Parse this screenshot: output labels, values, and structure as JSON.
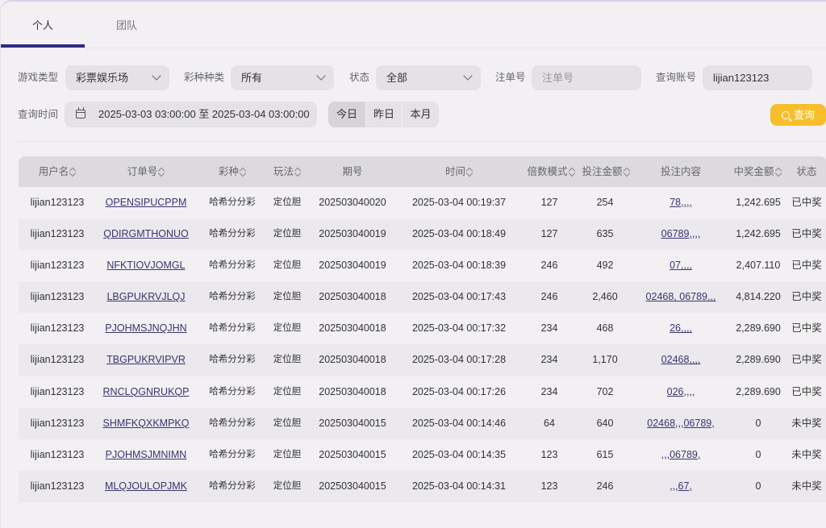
{
  "tabs": [
    {
      "label": "个人"
    },
    {
      "label": "团队"
    }
  ],
  "filters": {
    "game_type_label": "游戏类型",
    "game_type_value": "彩票娱乐场",
    "lottery_label": "彩种种类",
    "lottery_value": "所有",
    "status_label": "状态",
    "status_value": "全部",
    "order_label": "注单号",
    "order_placeholder": "注单号",
    "account_label": "查询账号",
    "account_value": "lijian123123",
    "time_label": "查询时间",
    "time_value": "2025-03-03 03:00:00 至 2025-03-04 03:00:00",
    "quick": [
      "今日",
      "昨日",
      "本月"
    ],
    "query_button": "查询"
  },
  "table": {
    "headers": [
      "用户名",
      "订单号",
      "彩种",
      "玩法",
      "期号",
      "时间",
      "倍数模式",
      "投注金额",
      "投注内容",
      "中奖金额",
      "状态"
    ],
    "rows": [
      [
        "lijian123123",
        "OPENSIPUCPPM",
        "哈希分分彩",
        "定位胆",
        "202503040020",
        "2025-03-04 00:19:37",
        "127",
        "254",
        "78,,,,",
        "1,242.695",
        "已中奖"
      ],
      [
        "lijian123123",
        "QDIRGMTHONUO",
        "哈希分分彩",
        "定位胆",
        "202503040019",
        "2025-03-04 00:18:49",
        "127",
        "635",
        "06789,,,,",
        "1,242.695",
        "已中奖"
      ],
      [
        "lijian123123",
        "NFKTIOVJOMGL",
        "哈希分分彩",
        "定位胆",
        "202503040019",
        "2025-03-04 00:18:39",
        "246",
        "492",
        "07,,,,",
        "2,407.110",
        "已中奖"
      ],
      [
        "lijian123123",
        "LBGPUKRVJLQJ",
        "哈希分分彩",
        "定位胆",
        "202503040018",
        "2025-03-04 00:17:43",
        "246",
        "2,460",
        "02468, 06789,,,",
        "4,814.220",
        "已中奖"
      ],
      [
        "lijian123123",
        "PJOHMSJNQJHN",
        "哈希分分彩",
        "定位胆",
        "202503040018",
        "2025-03-04 00:17:32",
        "234",
        "468",
        "26,,,,",
        "2,289.690",
        "已中奖"
      ],
      [
        "lijian123123",
        "TBGPUKRVIPVR",
        "哈希分分彩",
        "定位胆",
        "202503040018",
        "2025-03-04 00:17:28",
        "234",
        "1,170",
        "02468,,,,",
        "2,289.690",
        "已中奖"
      ],
      [
        "lijian123123",
        "RNCLQGNRUKQP",
        "哈希分分彩",
        "定位胆",
        "202503040018",
        "2025-03-04 00:17:26",
        "234",
        "702",
        "026,,,,",
        "2,289.690",
        "已中奖"
      ],
      [
        "lijian123123",
        "SHMFKQXKMPKQ",
        "哈希分分彩",
        "定位胆",
        "202503040015",
        "2025-03-04 00:14:46",
        "64",
        "640",
        "02468,,,06789,",
        "0",
        "未中奖"
      ],
      [
        "lijian123123",
        "PJOHMSJMNIMN",
        "哈希分分彩",
        "定位胆",
        "202503040015",
        "2025-03-04 00:14:35",
        "123",
        "615",
        ",,,06789,",
        "0",
        "未中奖"
      ],
      [
        "lijian123123",
        "MLQJOULOPJMK",
        "哈希分分彩",
        "定位胆",
        "202503040015",
        "2025-03-04 00:14:31",
        "123",
        "246",
        ",,,67,",
        "0",
        "未中奖"
      ]
    ]
  }
}
